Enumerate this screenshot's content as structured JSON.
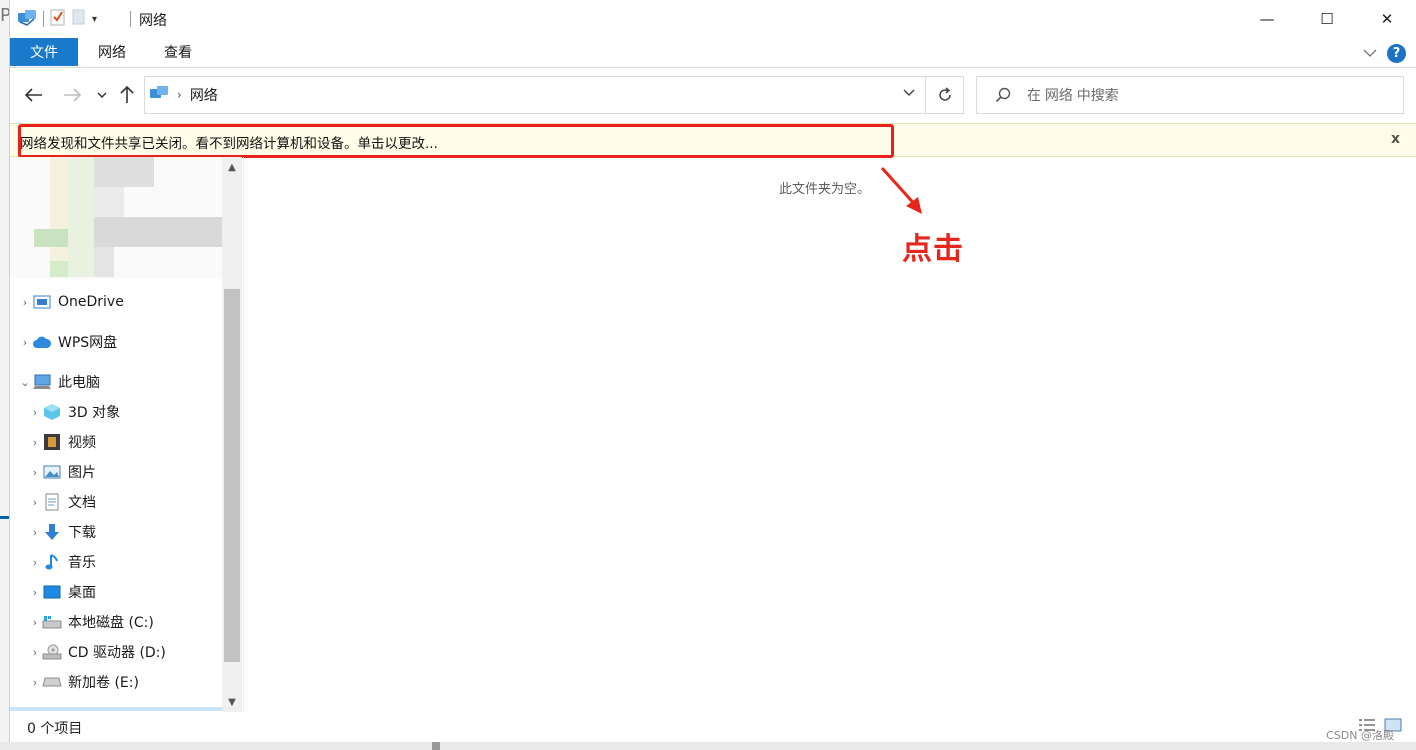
{
  "window": {
    "title": "网络",
    "controls": {
      "minimize": "—",
      "maximize": "☐",
      "close": "✕"
    }
  },
  "ribbon": {
    "tabs": [
      {
        "label": "文件"
      },
      {
        "label": "网络"
      },
      {
        "label": "查看"
      }
    ],
    "help": "?"
  },
  "address": {
    "crumb": "网络",
    "search_placeholder": "在 网络 中搜索"
  },
  "infobar": {
    "message": "网络发现和文件共享已关闭。看不到网络计算机和设备。单击以更改...",
    "close": "x"
  },
  "nav_tree": [
    {
      "label": "OneDrive",
      "icon": "onedrive-icon",
      "expanded": false
    },
    {
      "label": "WPS网盘",
      "icon": "cloud-icon",
      "expanded": false
    },
    {
      "label": "此电脑",
      "icon": "computer-icon",
      "expanded": true
    },
    {
      "label": "3D 对象",
      "icon": "cube-3d-icon",
      "expanded": false
    },
    {
      "label": "视频",
      "icon": "film-icon",
      "expanded": false
    },
    {
      "label": "图片",
      "icon": "picture-icon",
      "expanded": false
    },
    {
      "label": "文档",
      "icon": "document-icon",
      "expanded": false
    },
    {
      "label": "下载",
      "icon": "download-icon",
      "expanded": false
    },
    {
      "label": "音乐",
      "icon": "music-icon",
      "expanded": false
    },
    {
      "label": "桌面",
      "icon": "desktop-icon",
      "expanded": false
    },
    {
      "label": "本地磁盘 (C:)",
      "icon": "drive-c-icon",
      "expanded": false
    },
    {
      "label": "CD 驱动器 (D:)",
      "icon": "cd-drive-icon",
      "expanded": false
    },
    {
      "label": "新加卷 (E:)",
      "icon": "drive-icon",
      "expanded": false
    }
  ],
  "content": {
    "empty_message": "此文件夹为空。"
  },
  "annotation": {
    "label": "点击",
    "color": "#e5261c"
  },
  "status": {
    "item_count": "0 个项目",
    "watermark": "CSDN @洛殿"
  },
  "colors": {
    "accent": "#1979ca",
    "infobar_bg": "#fffde7",
    "highlight": "#e8221b"
  }
}
